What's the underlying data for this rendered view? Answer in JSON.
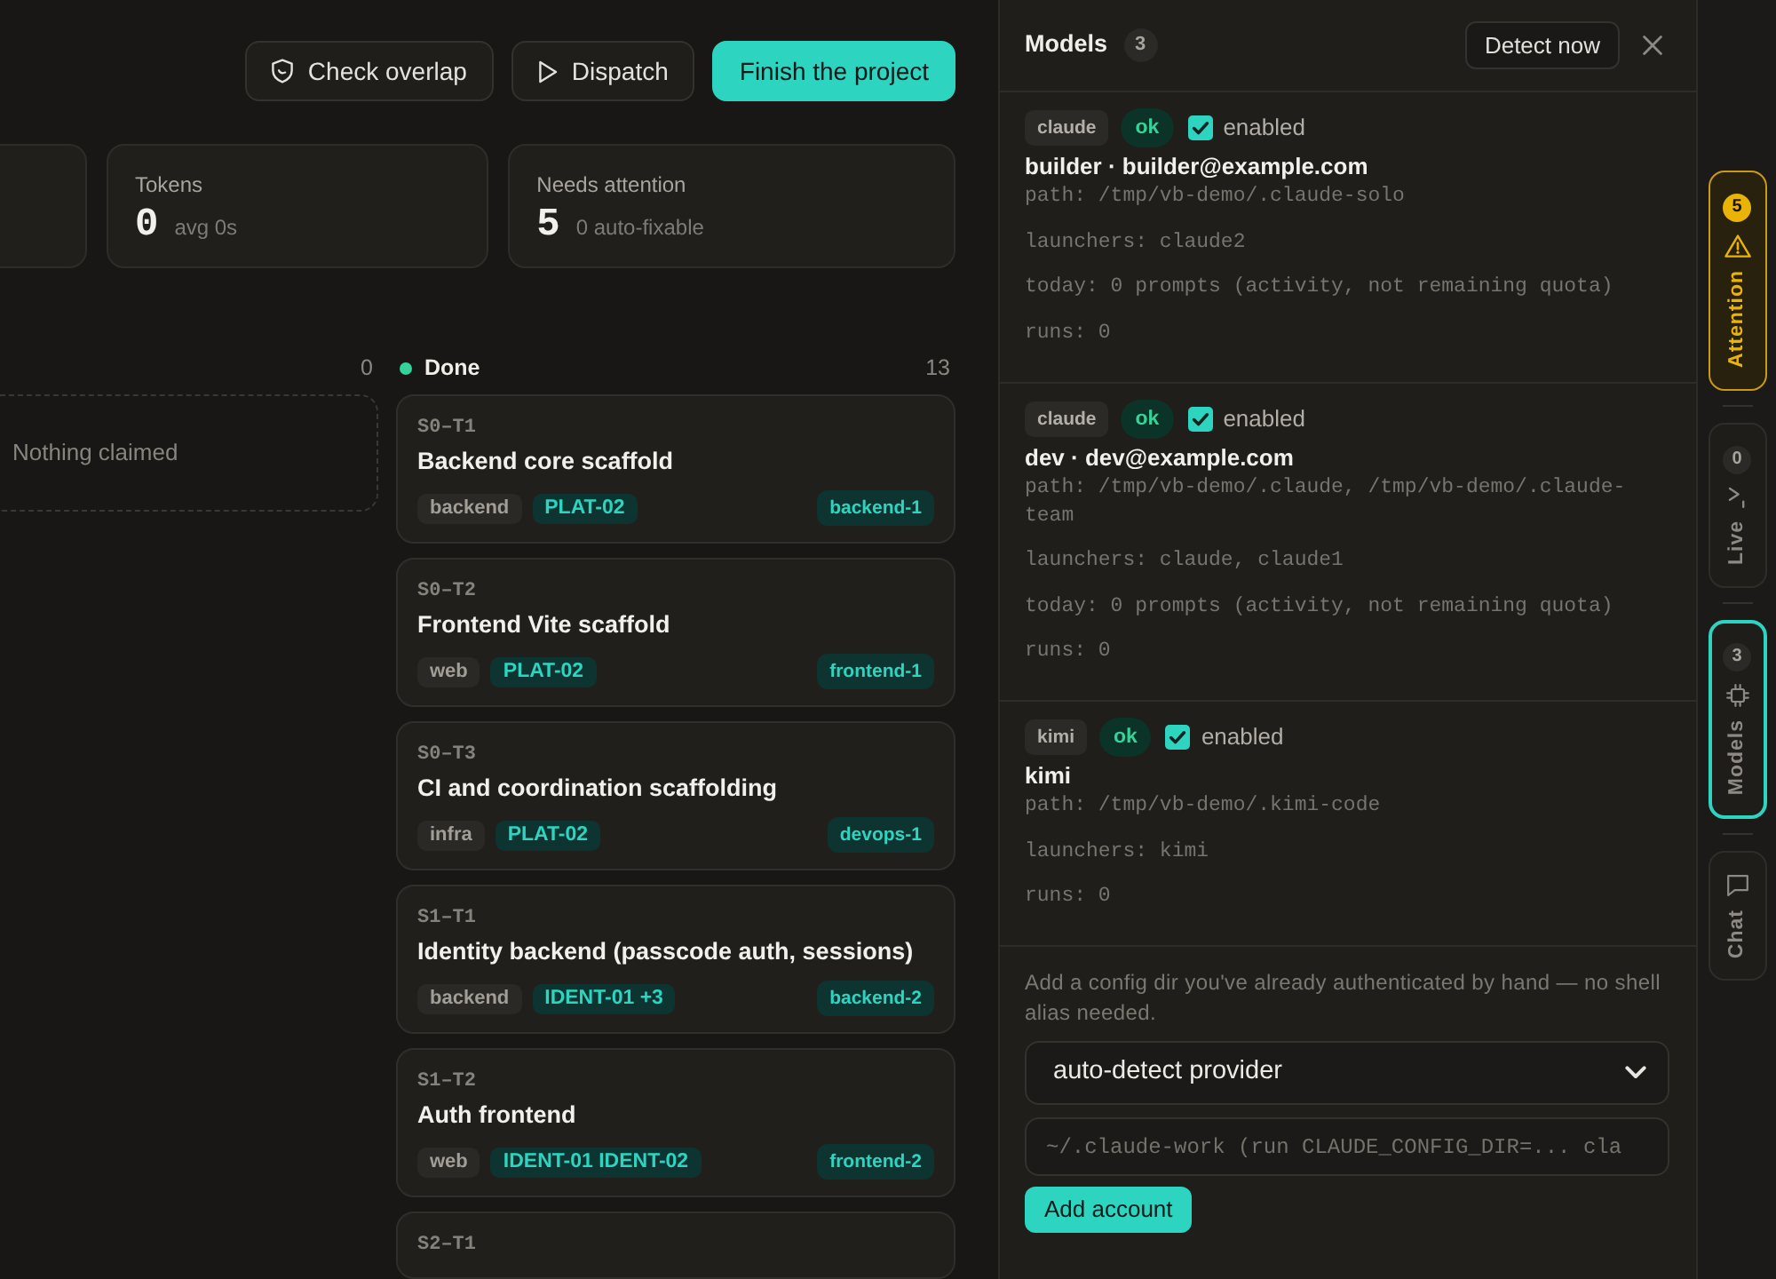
{
  "toolbar": {
    "buttons": [
      {
        "label": "Check overlap",
        "kind": "outline"
      },
      {
        "label": "Dispatch",
        "kind": "outline"
      },
      {
        "label": "Finish the project",
        "kind": "primary"
      }
    ]
  },
  "stats": [
    {
      "label": "Tokens",
      "value": "0",
      "note": "avg 0s"
    },
    {
      "label": "Needs attention",
      "value": "5",
      "note": "0 auto-fixable"
    }
  ],
  "columns": [
    {
      "count": "0",
      "empty_text": "Nothing claimed"
    },
    {
      "title": "Done",
      "color": "#34d399",
      "count": "13",
      "cards": [
        {
          "id": "S0–T1",
          "title": "Backend core scaffold",
          "area": "backend",
          "requirement": "PLAT-02",
          "assignee": "backend-1"
        },
        {
          "id": "S0–T2",
          "title": "Frontend Vite scaffold",
          "area": "web",
          "requirement": "PLAT-02",
          "assignee": "frontend-1"
        },
        {
          "id": "S0–T3",
          "title": "CI and coordination scaffolding",
          "area": "infra",
          "requirement": "PLAT-02",
          "assignee": "devops-1"
        },
        {
          "id": "S1–T1",
          "title": "Identity backend (passcode auth, sessions)",
          "area": "backend",
          "requirement": "IDENT-01 +3",
          "assignee": "backend-2"
        },
        {
          "id": "S1–T2",
          "title": "Auth frontend",
          "area": "web",
          "requirement": "IDENT-01 IDENT-02",
          "assignee": "frontend-2"
        },
        {
          "id": "S2–T1"
        }
      ]
    }
  ],
  "models_panel": {
    "title": "Models",
    "count": "3",
    "detect_button": "Detect now",
    "accounts": [
      {
        "provider": "claude",
        "status": "ok",
        "enabled": true,
        "enabled_label": "enabled",
        "name": "builder · builder@example.com",
        "details": [
          "path: /tmp/vb-demo/.claude-solo",
          "launchers: claude2",
          "today: 0 prompts (activity, not remaining quota)",
          "runs: 0"
        ]
      },
      {
        "provider": "claude",
        "status": "ok",
        "enabled": true,
        "enabled_label": "enabled",
        "name": "dev · dev@example.com",
        "details": [
          "path: /tmp/vb-demo/.claude, /tmp/vb-demo/.claude-team",
          "launchers: claude, claude1",
          "today: 0 prompts (activity, not remaining quota)",
          "runs: 0"
        ]
      },
      {
        "provider": "kimi",
        "status": "ok",
        "enabled": true,
        "enabled_label": "enabled",
        "name": "kimi",
        "details": [
          "path: /tmp/vb-demo/.kimi-code",
          "launchers: kimi",
          "runs: 0"
        ]
      }
    ],
    "add_form": {
      "hint": "Add a config dir you've already authenticated by hand — no shell alias needed.",
      "provider_select": {
        "value": "auto-detect provider"
      },
      "config_dir_field": {
        "placeholder": "~/.claude-work (run CLAUDE_CONFIG_DIR=... cla"
      },
      "submit_button": "Add account"
    }
  },
  "rail": [
    {
      "label": "Attention",
      "count": "5",
      "kind": "warning",
      "selected": false
    },
    {
      "label": "Live",
      "count": "0",
      "kind": "default",
      "selected": false
    },
    {
      "label": "Models",
      "count": "3",
      "kind": "default",
      "selected": true
    },
    {
      "label": "Chat",
      "kind": "default",
      "selected": false
    }
  ]
}
